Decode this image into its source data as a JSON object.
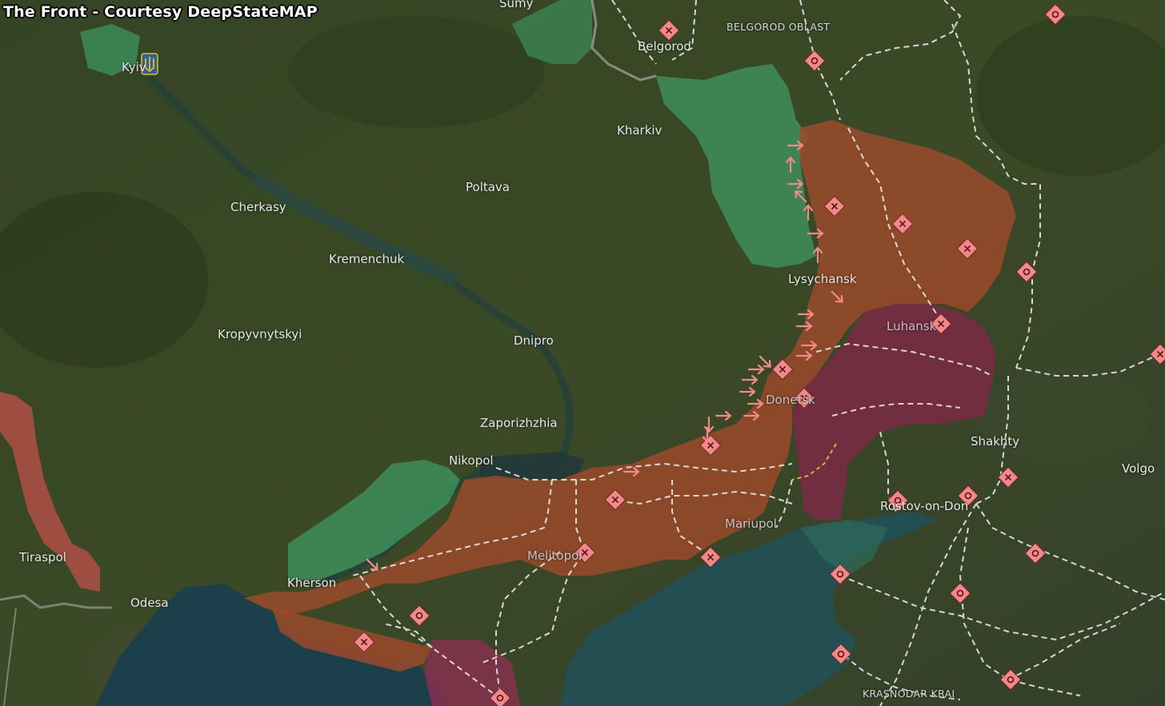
{
  "title": "The Front - Courtesy DeepStateMAP",
  "cities": {
    "sumy": "Sumy",
    "kyiv": "Kyiv",
    "belgorod": "Belgorod",
    "kharkiv": "Kharkiv",
    "poltava": "Poltava",
    "cherkasy": "Cherkasy",
    "kremenchuk": "Kremenchuk",
    "kropyvnytskyi": "Kropyvnytskyi",
    "dnipro": "Dnipro",
    "zaporizhzhia": "Zaporizhzhia",
    "nikopol": "Nikopol",
    "lysychansk": "Lysychansk",
    "luhansk": "Luhansk",
    "donetsk": "Donetsk",
    "shakhty": "Shakhty",
    "volgograd": "Volgo",
    "rostov": "Rostov-on-Don",
    "mariupol": "Mariupol",
    "melitopol": "Melitopol",
    "kherson": "Kherson",
    "odesa": "Odesa",
    "tiraspol": "Tiraspol"
  },
  "regions": {
    "belgorod_oblast": "BELGOROD OBLAST",
    "krasnodar_krai": "KRASNODAR KRAI"
  },
  "map_layers": {
    "occupied_color": "#9a4a2a",
    "pre2022_occupied_color": "#7a2a45",
    "liberated_color": "#3d9a62",
    "transnistria_color": "#c0504a",
    "marker_color": "#f08a8a",
    "railway_color": "#e8e8e8",
    "sea_color": "#1f4a55"
  },
  "icons": [
    "ukraine-trident-icon",
    "strike-marker-icon",
    "military-base-icon",
    "advance-arrow-icon"
  ]
}
